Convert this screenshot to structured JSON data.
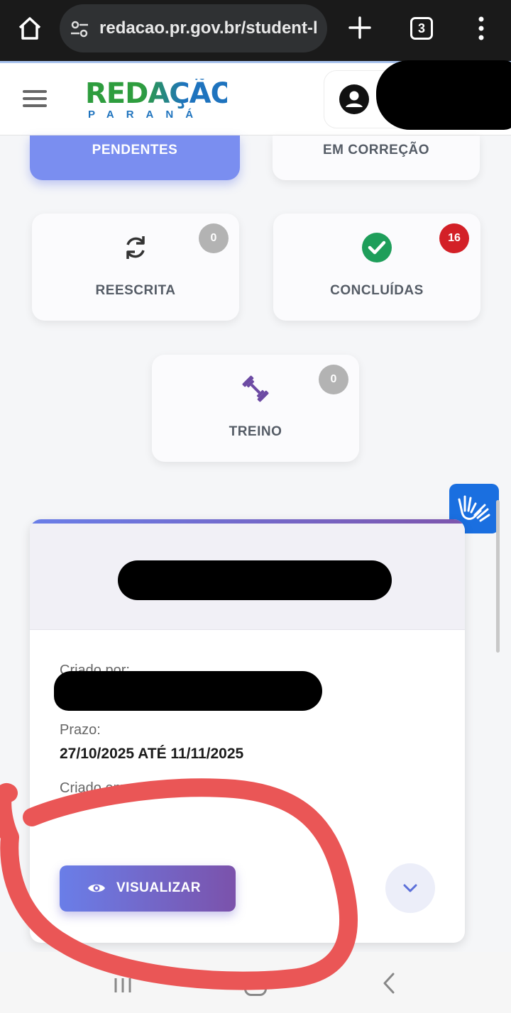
{
  "browser": {
    "url": "redacao.pr.gov.br/student-l",
    "tab_count": "3"
  },
  "header": {
    "logo_main": "REDAÇÃO",
    "logo_sub": "PARANÁ"
  },
  "status_cards": {
    "pendentes": {
      "label": "PENDENTES"
    },
    "em_correcao": {
      "label": "EM CORREÇÃO"
    },
    "reescrita": {
      "label": "REESCRITA",
      "count": "0"
    },
    "concluidas": {
      "label": "CONCLUÍDAS",
      "count": "16"
    },
    "treino": {
      "label": "TREINO",
      "count": "0"
    }
  },
  "essay_card": {
    "created_by_label": "Criado por:",
    "deadline_label": "Prazo:",
    "deadline_value": "27/10/2025 ATÉ 11/11/2025",
    "created_on_label": "Criado em:",
    "view_button": "VISUALIZAR"
  },
  "colors": {
    "accent": "#7a8ef0",
    "badge_grey": "#b3b3b3",
    "badge_red": "#d32027",
    "success_green": "#1e9e5a",
    "treino_purple": "#6c4aa3",
    "annotation_red": "#ea5656"
  },
  "icons": {
    "home": "home-icon",
    "site_settings": "tune-icon",
    "new_tab": "plus-icon",
    "tab_switcher": "tab-switcher-icon",
    "more": "more-vert-icon",
    "menu": "hamburger-icon",
    "user": "account-circle-icon",
    "reescrita": "refresh-icon",
    "concluidas": "check-circle-icon",
    "treino": "dumbbell-icon",
    "accessibility": "sign-language-icon",
    "view": "eye-icon",
    "expand": "chevron-down-icon"
  }
}
